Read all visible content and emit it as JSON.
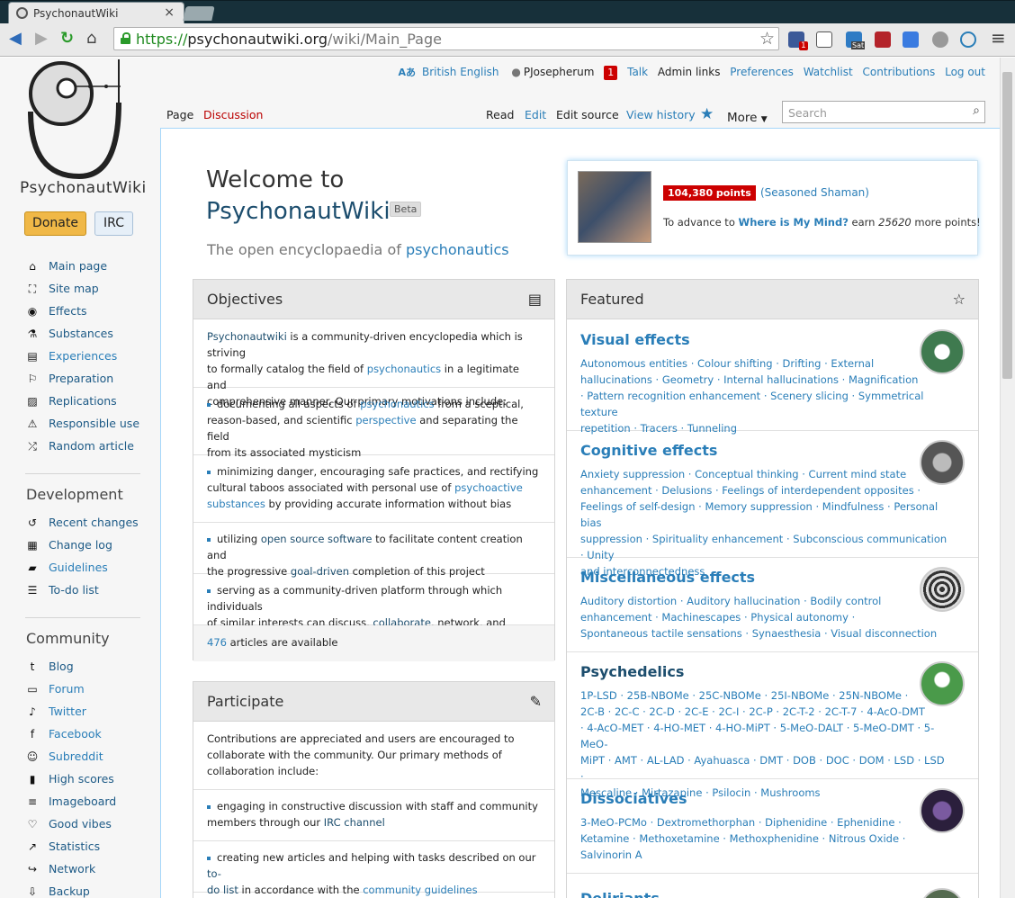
{
  "browser": {
    "tab_title": "PsychonautWiki",
    "tab_close": "×",
    "url_scheme": "https://",
    "url_host": "psychonautwiki.org",
    "url_path": "/wiki/Main_Page",
    "ext_badge_count": "1",
    "ext_badge_sat": "Sat"
  },
  "sidebar": {
    "logo_text": "PsychonautWiki",
    "donate_label": "Donate",
    "irc_label": "IRC",
    "nav": [
      {
        "icon": "⌂",
        "label": "Main page"
      },
      {
        "icon": "⛶",
        "label": "Site map"
      },
      {
        "icon": "◉",
        "label": "Effects"
      },
      {
        "icon": "⚗",
        "label": "Substances"
      },
      {
        "icon": "▤",
        "label": "Experiences"
      },
      {
        "icon": "⚐",
        "label": "Preparation"
      },
      {
        "icon": "▨",
        "label": "Replications"
      },
      {
        "icon": "⚠",
        "label": "Responsible use"
      },
      {
        "icon": "⤮",
        "label": "Random article"
      }
    ],
    "dev_heading": "Development",
    "dev": [
      {
        "icon": "↺",
        "label": "Recent changes"
      },
      {
        "icon": "▦",
        "label": "Change log"
      },
      {
        "icon": "▰",
        "label": "Guidelines"
      },
      {
        "icon": "☰",
        "label": "To-do list"
      }
    ],
    "community_heading": "Community",
    "community": [
      {
        "icon": "t",
        "label": "Blog"
      },
      {
        "icon": "▭",
        "label": "Forum"
      },
      {
        "icon": "♪",
        "label": "Twitter"
      },
      {
        "icon": "f",
        "label": "Facebook"
      },
      {
        "icon": "☺",
        "label": "Subreddit"
      },
      {
        "icon": "▮",
        "label": "High scores"
      },
      {
        "icon": "≡",
        "label": "Imageboard"
      },
      {
        "icon": "♡",
        "label": "Good vibes"
      },
      {
        "icon": "↗",
        "label": "Statistics"
      },
      {
        "icon": "↪",
        "label": "Network"
      },
      {
        "icon": "⇩",
        "label": "Backup"
      }
    ]
  },
  "personal": {
    "language": "British English",
    "username": "PJosepherum",
    "notifications": "1",
    "talk": "Talk",
    "admin": "Admin links",
    "preferences": "Preferences",
    "watchlist": "Watchlist",
    "contributions": "Contributions",
    "logout": "Log out"
  },
  "tabs": {
    "page": "Page",
    "discussion": "Discussion",
    "read": "Read",
    "edit": "Edit",
    "edit_source": "Edit source",
    "history": "View history",
    "more": "More",
    "search_placeholder": "Search"
  },
  "welcome": {
    "line1": "Welcome to",
    "line2": "PsychonautWiki",
    "beta": "Beta",
    "tagline_prefix": "The open encyclopaedia of ",
    "tagline_link": "psychonautics"
  },
  "user_box": {
    "points": "104,380 points",
    "rank": "(Seasoned Shaman)",
    "advance_prefix": "To advance to ",
    "advance_target": "Where is My Mind?",
    "advance_mid": " earn ",
    "advance_amount": "25620",
    "advance_suffix": " more points!"
  },
  "objectives": {
    "title": "Objectives",
    "intro_link": "Psychonautwiki",
    "intro_a": " is a community-driven encyclopedia which is striving",
    "intro_b": "to formally catalog the field of ",
    "intro_link2": "psychonautics",
    "intro_c": " in a legitimate and",
    "intro_d": "comprehensive manner. Our primary motivations include:",
    "b1_a": "documenting all aspects of ",
    "b1_link": "psychonautics",
    "b1_b": " from a sceptical,",
    "b1_c": "reason-based, and scientific ",
    "b1_link2": "perspective",
    "b1_d": " and separating the field",
    "b1_e": "from its associated mysticism",
    "b2_a": "minimizing danger, encouraging safe practices, and rectifying",
    "b2_b": "cultural taboos associated with personal use of ",
    "b2_link": "psychoactive",
    "b2_link2": "substances",
    "b2_c": " by providing accurate information without bias",
    "b3_a": "utilizing ",
    "b3_link": "open source software",
    "b3_b": " to facilitate content creation and",
    "b3_c": "the progressive ",
    "b3_link2": "goal-driven",
    "b3_d": " completion of this project",
    "b4_a": "serving as a community-driven platform through which individuals",
    "b4_b": "of similar interests can discuss, ",
    "b4_link": "collaborate",
    "b4_c": ", network, and organize",
    "count": "476",
    "count_suffix": " articles are available"
  },
  "participate": {
    "title": "Participate",
    "intro_a": "Contributions are appreciated and users are encouraged to",
    "intro_b": "collaborate with the community. Our primary methods of",
    "intro_c": "collaboration include:",
    "b1_a": "engaging in constructive discussion with staff and community",
    "b1_b": "members through our ",
    "b1_link": "IRC channel",
    "b2_a": "creating new articles and helping with tasks described on our ",
    "b2_link": "to-",
    "b2_link2": "do list",
    "b2_b": " in accordance with the ",
    "b2_link3": "community guidelines"
  },
  "featured": {
    "title": "Featured",
    "sections": [
      {
        "title": "Visual effects",
        "lines": [
          "Autonomous entities · Colour shifting · Drifting · External",
          "hallucinations · Geometry · Internal hallucinations · Magnification",
          "· Pattern recognition enhancement · Scenery slicing · Symmetrical texture",
          "repetition · Tracers · Tunneling"
        ]
      },
      {
        "title": "Cognitive effects",
        "lines": [
          "Anxiety suppression · Conceptual thinking · Current mind state",
          "enhancement · Delusions · Feelings of interdependent opposites ·",
          "Feelings of self-design · Memory suppression · Mindfulness · Personal bias",
          "suppression · Spirituality enhancement · Subconscious communication · Unity",
          "and interconnectedness"
        ]
      },
      {
        "title": "Miscellaneous effects",
        "lines": [
          "Auditory distortion · Auditory hallucination · Bodily control",
          "enhancement · Machinescapes · Physical autonomy ·",
          "Spontaneous tactile sensations · Synaesthesia · Visual disconnection"
        ]
      },
      {
        "title": "Psychedelics",
        "lines": [
          "1P-LSD · 25B-NBOMe · 25C-NBOMe · 25I-NBOMe · 25N-NBOMe ·",
          "2C-B · 2C-C · 2C-D · 2C-E · 2C-I · 2C-P · 2C-T-2 · 2C-T-7 · 4-AcO-DMT",
          "· 4-AcO-MET · 4-HO-MET · 4-HO-MiPT · 5-MeO-DALT · 5-MeO-DMT · 5-MeO-",
          "MiPT · AMT · AL-LAD · Ayahuasca · DMT · DOB · DOC · DOM · LSD · LSD ·",
          "Mescaline · Mirtazapine · Psilocin · Mushrooms"
        ]
      },
      {
        "title": "Dissociatives",
        "lines": [
          "3-MeO-PCMo · Dextromethorphan · Diphenidine · Ephenidine ·",
          "Ketamine · Methoxetamine · Methoxphenidine · Nitrous Oxide ·",
          "Salvinorin A"
        ]
      },
      {
        "title": "Deliriants",
        "lines": []
      }
    ]
  }
}
